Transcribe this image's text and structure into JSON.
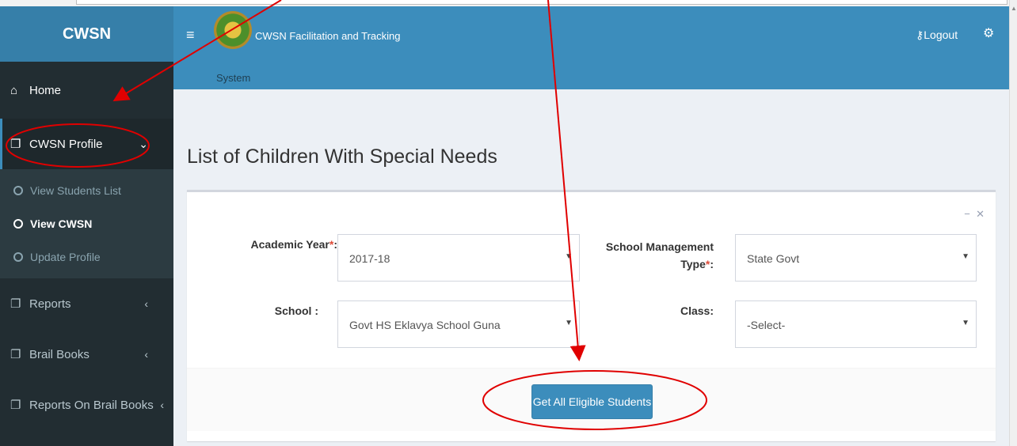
{
  "sidebar": {
    "brand": "CWSN",
    "home": "Home",
    "profile": "CWSN Profile",
    "sub": [
      "View Students List",
      "View CWSN",
      "Update Profile"
    ],
    "reports": "Reports",
    "brail": "Brail Books",
    "reports_brail": "Reports On Brail Books"
  },
  "header": {
    "title_line1": "CWSN Facilitation and Tracking",
    "title_line2": "System",
    "logout": "Logout"
  },
  "page": {
    "title": "List of Children With Special Needs",
    "academic_year_label": "Academic Year",
    "academic_year_value": "2017-18",
    "mgmt_label_1": "School Management",
    "mgmt_label_2": "Type",
    "mgmt_value": "State Govt",
    "school_label": "School :",
    "school_value": "Govt HS Eklavya School Guna",
    "class_label": "Class:",
    "class_value": "-Select-",
    "button": "Get All Eligible Students",
    "req": "*",
    "colon": ":"
  },
  "colors": {
    "annotation": "#e00000",
    "accent": "#3c8dbc"
  }
}
